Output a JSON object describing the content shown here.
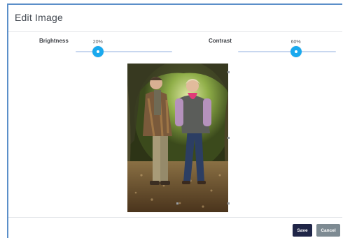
{
  "dialog": {
    "title": "Edit Image"
  },
  "controls": {
    "brightness": {
      "label": "Brightness",
      "value_text": "20%",
      "value": 0.2
    },
    "contrast": {
      "label": "Contrast",
      "value_text": "60%",
      "value": 0.6
    }
  },
  "footer": {
    "save_label": "Save",
    "cancel_label": "Cancel"
  },
  "colors": {
    "accent": "#1aa9ee",
    "save_button": "#1f2547",
    "cancel_button": "#7d8a92",
    "border": "#5b8fc9"
  }
}
